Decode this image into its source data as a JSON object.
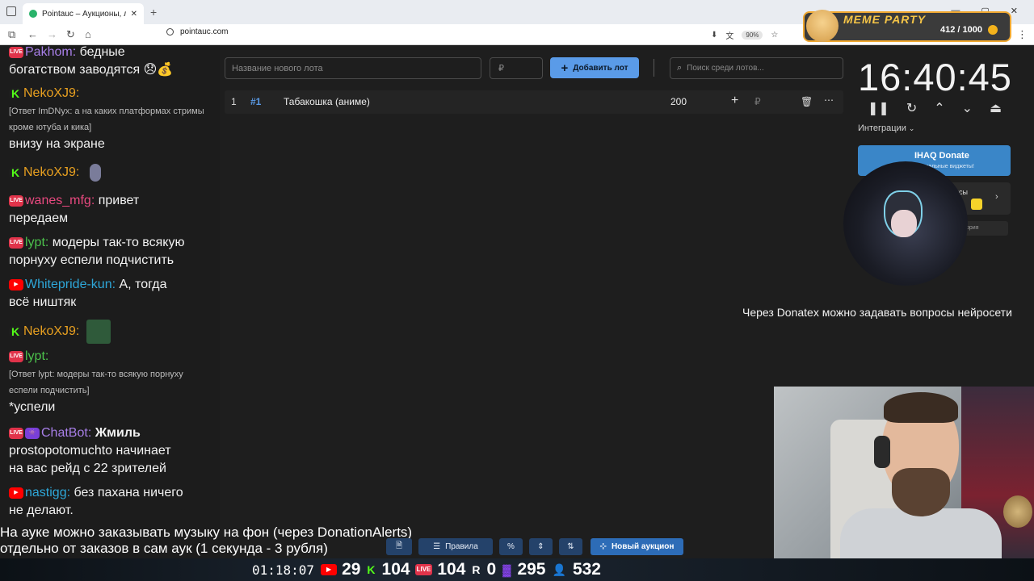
{
  "browser": {
    "tab_title": "Pointauc – Аукционы, лотере",
    "tab_close": "✕",
    "new_tab": "+",
    "url": "pointauc.com",
    "zoom": "90%",
    "window_buttons": [
      "—",
      "▢",
      "✕"
    ]
  },
  "meme_party": {
    "title": "MEME PARTY",
    "count": "412 / 1000"
  },
  "chat": {
    "messages": [
      {
        "name": "Pakhom:",
        "text": "бедные",
        "line2": "богатством заводятся 😞💰"
      },
      {
        "name": "NekoXJ9:",
        "text": ""
      },
      {
        "reply": "[Ответ ImDNyx: а на каких платформах стримы",
        "reply2": "кроме ютуба и кика]",
        "line2": "внизу на экране"
      },
      {
        "name": "NekoXJ9:",
        "text": ""
      },
      {
        "name": "wanes_mfg:",
        "text": "привет",
        "line2": "передаем"
      },
      {
        "name": "lypt:",
        "text": "модеры так-то всякую",
        "line2": "порнуху еспели подчистить"
      },
      {
        "name": "Whitepride-kun:",
        "text": "А, тогда",
        "line2": "всё ништяк"
      },
      {
        "name": "NekoXJ9:",
        "text": ""
      },
      {
        "name": "lypt:",
        "text": ""
      },
      {
        "reply": "[Ответ lypt: модеры так-то всякую порнуху",
        "reply2": "еспели подчистить]",
        "line2": "*успели"
      },
      {
        "name": "ChatBot:",
        "text": "Жмиль",
        "line2": "prostopotomuchto начинает",
        "line3": "на вас рейд с 22 зрителей"
      },
      {
        "name": "nastigg:",
        "text": "без пахана ничего",
        "line2": "не делают."
      }
    ]
  },
  "auction": {
    "lot_name_placeholder": "Название нового лота",
    "lot_sum_placeholder": "₽",
    "add_lot_label": "Добавить лот",
    "search_placeholder": "Поиск среди лотов...",
    "lots": [
      {
        "index": "1",
        "id": "#1",
        "name": "Табакошка (аниме)",
        "amount": "200",
        "currency": "₽"
      }
    ]
  },
  "timer": {
    "time": "16:40:45",
    "integrations_label": "Интеграции",
    "ihaq_title": "IHAQ Donate",
    "ihaq_sub": "кальные виджеты!",
    "services_label": "исы",
    "history_label": "ория"
  },
  "overlay": {
    "donatex_text": "Через Donatex можно задавать вопросы нейросети",
    "tip_line1": "На ауке можно заказывать музыку на фон (через DonationAlerts)",
    "tip_line2": "отдельно от заказов в сам аук (1 секунда - 3 рубля)",
    "rules_label": "Правила",
    "new_auction_label": "Новый аукцион"
  },
  "stats": {
    "uptime": "01:18:07",
    "youtube": "29",
    "kick": "104",
    "vk": "104",
    "rutube": "0",
    "twitch": "295",
    "total": "532"
  },
  "colors": {
    "accent_blue": "#5a9be8",
    "app_bg": "#1e1e1e",
    "meme_gold": "#f6c547"
  }
}
